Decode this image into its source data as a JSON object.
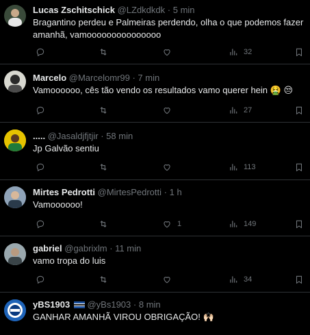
{
  "tweets": [
    {
      "name": "Lucas Zschitschick",
      "handle": "@LZdkdkdk",
      "dot": "·",
      "time": "5 min",
      "text": "Bragantino perdeu e Palmeiras perdendo, olha o que podemos fazer amanhã, vamooooooooooooooo",
      "replies": "",
      "retweets": "",
      "likes": "",
      "views": "32",
      "avatar_color": "#3a4a3a"
    },
    {
      "name": "Marcelo",
      "handle": "@Marcelomr99",
      "dot": "·",
      "time": "7 min",
      "text": "Vamoooooo, cês tão vendo os resultados vamo querer hein 🤮 😒",
      "replies": "",
      "retweets": "",
      "likes": "",
      "views": "27",
      "avatar_color": "#6a6a5a"
    },
    {
      "name": ".....",
      "handle": "@Jasaldjfjtjir",
      "dot": "·",
      "time": "58 min",
      "text": "Jp Galvão sentiu",
      "replies": "",
      "retweets": "",
      "likes": "",
      "views": "113",
      "avatar_color": "#d4b400"
    },
    {
      "name": "Mirtes Pedrotti",
      "handle": "@MirtesPedrotti",
      "dot": "·",
      "time": "1 h",
      "text": "Vamoooooo!",
      "replies": "",
      "retweets": "",
      "likes": "1",
      "views": "149",
      "avatar_color": "#5a6c80"
    },
    {
      "name": "gabriel",
      "handle": "@gabrixlm",
      "dot": "·",
      "time": "11 min",
      "text": "vamo tropa do luis",
      "replies": "",
      "retweets": "",
      "likes": "",
      "views": "34",
      "avatar_color": "#8a9aa0"
    },
    {
      "name": "yBS1903",
      "handle": "@yBs1903",
      "dot": "·",
      "time": "8 min",
      "text": "GANHAR AMANHÃ VIROU OBRIGAÇÃO! 🙌🏻",
      "replies": "",
      "retweets": "",
      "likes": "",
      "views": "",
      "avatar_color": "#1e63b8"
    }
  ],
  "icons": [
    "reply-icon",
    "retweet-icon",
    "like-icon",
    "views-icon",
    "bookmark-icon"
  ],
  "colors": {
    "background": "#000000",
    "text": "#e7e9ea",
    "muted": "#71767b",
    "divider": "#2f3336"
  }
}
